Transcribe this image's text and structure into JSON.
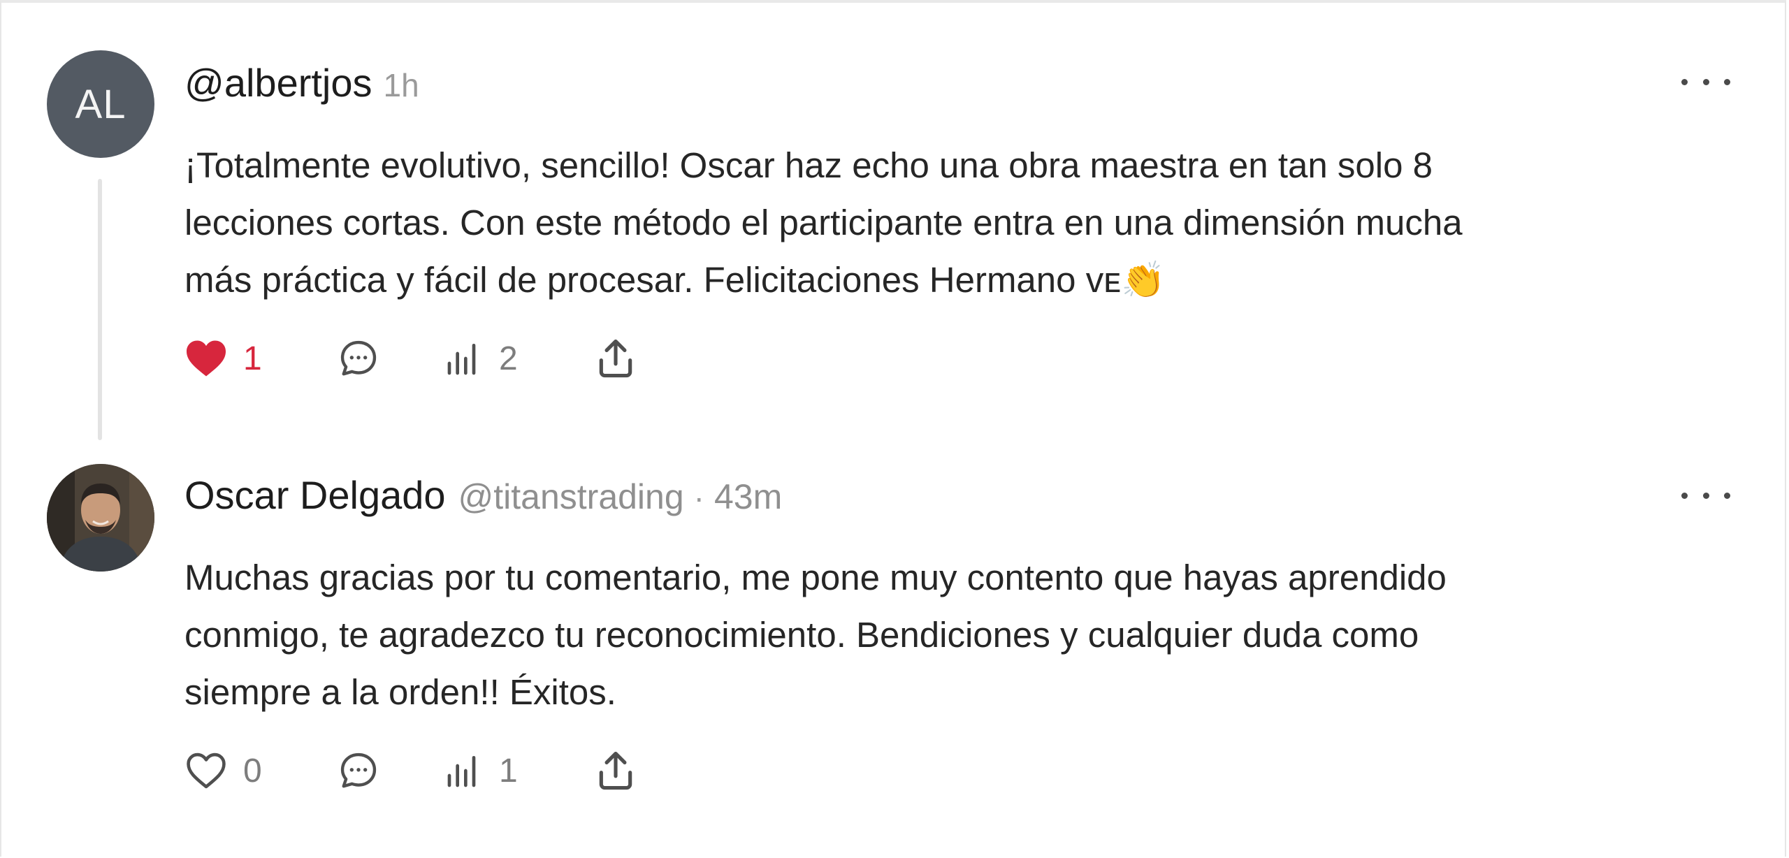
{
  "comments": [
    {
      "avatar_initials": "AL",
      "handle": "@albertjos",
      "time": "1h",
      "body": "¡Totalmente evolutivo, sencillo! Oscar haz echo una obra maestra en tan solo 8\nlecciones cortas. Con este método el participante entra en una dimensión mucha\nmás práctica y fácil de procesar. Felicitaciones Hermano ᴠᴇ👏",
      "likes": "1",
      "liked": true,
      "views": "2"
    },
    {
      "name": "Oscar Delgado",
      "handle": "@titanstrading",
      "time_sep": "·",
      "time": "43m",
      "body": "Muchas gracias por tu comentario, me pone muy contento que hayas aprendido\nconmigo, te agradezco tu reconocimiento. Bendiciones y cualquier duda como\nsiempre a la orden!! Éxitos.",
      "likes": "0",
      "liked": false,
      "views": "1"
    }
  ],
  "colors": {
    "like_active": "#d7263d",
    "icon": "#4f4f4f",
    "muted_text": "#8f8f8f"
  },
  "icons": [
    "heart-icon",
    "comment-icon",
    "views-icon",
    "share-icon",
    "more-options-icon"
  ]
}
